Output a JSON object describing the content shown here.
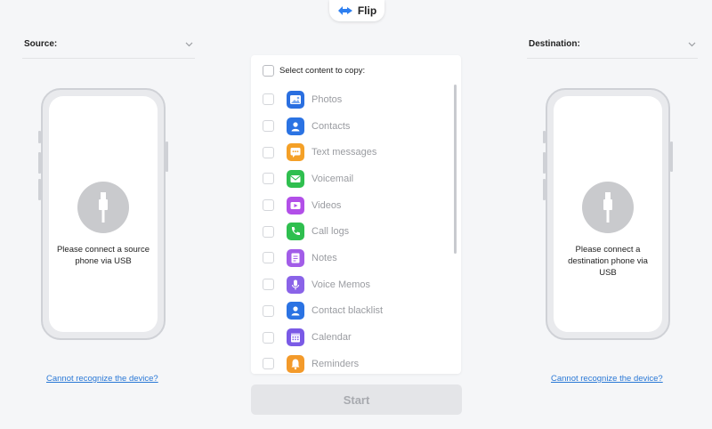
{
  "flip": {
    "label": "Flip",
    "icon": "flip-arrows-icon",
    "color": "#2d7ff0"
  },
  "source": {
    "label": "Source:",
    "message": "Please connect a source phone via USB",
    "cannot_link": "Cannot recognize the device?"
  },
  "destination": {
    "label": "Destination:",
    "message": "Please connect a destination phone via USB",
    "cannot_link": "Cannot recognize the device?"
  },
  "content": {
    "header": "Select content to copy:",
    "items": [
      {
        "label": "Photos",
        "icon": "photos-icon",
        "color": "#2a6fe0"
      },
      {
        "label": "Contacts",
        "icon": "contacts-icon",
        "color": "#2b73e3"
      },
      {
        "label": "Text messages",
        "icon": "messages-icon",
        "color": "#f4a027"
      },
      {
        "label": "Voicemail",
        "icon": "voicemail-icon",
        "color": "#2fbf4f"
      },
      {
        "label": "Videos",
        "icon": "videos-icon",
        "color": "#b24fe8"
      },
      {
        "label": "Call logs",
        "icon": "call-logs-icon",
        "color": "#2fbf4f"
      },
      {
        "label": "Notes",
        "icon": "notes-icon",
        "color": "#a25de8"
      },
      {
        "label": "Voice Memos",
        "icon": "voice-memos-icon",
        "color": "#8a63e8"
      },
      {
        "label": "Contact blacklist",
        "icon": "contact-blacklist-icon",
        "color": "#2b73e3"
      },
      {
        "label": "Calendar",
        "icon": "calendar-icon",
        "color": "#7a5ae6"
      },
      {
        "label": "Reminders",
        "icon": "reminders-icon",
        "color": "#f39a2a"
      }
    ]
  },
  "start": {
    "label": "Start"
  }
}
